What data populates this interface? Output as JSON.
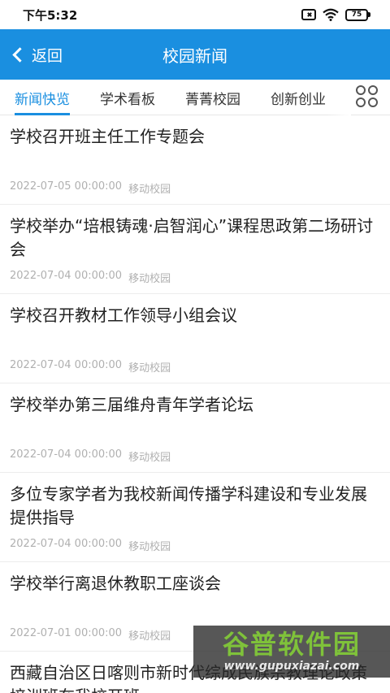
{
  "status_bar": {
    "time": "下午5:32",
    "battery": "75",
    "icons": [
      "sim-off-icon",
      "wifi-icon",
      "battery-icon"
    ]
  },
  "nav": {
    "back_label": "返回",
    "title": "校园新闻"
  },
  "tabs": [
    {
      "label": "新闻快览",
      "active": true
    },
    {
      "label": "学术看板",
      "active": false
    },
    {
      "label": "菁菁校园",
      "active": false
    },
    {
      "label": "创新创业",
      "active": false
    }
  ],
  "news": [
    {
      "title": "学校召开班主任工作专题会",
      "date": "2022-07-05 00:00:00",
      "source": "移动校园"
    },
    {
      "title": "学校举办“培根铸魂·启智润心”课程思政第二场研讨会",
      "date": "2022-07-04 00:00:00",
      "source": "移动校园"
    },
    {
      "title": "学校召开教材工作领导小组会议",
      "date": "2022-07-04 00:00:00",
      "source": "移动校园"
    },
    {
      "title": "学校举办第三届维舟青年学者论坛",
      "date": "2022-07-04 00:00:00",
      "source": "移动校园"
    },
    {
      "title": "多位专家学者为我校新闻传播学科建设和专业发展提供指导",
      "date": "2022-07-04 00:00:00",
      "source": "移动校园"
    },
    {
      "title": "学校举行离退休教职工座谈会",
      "date": "2022-07-01 00:00:00",
      "source": "移动校园"
    },
    {
      "title": "西藏自治区日喀则市新时代综成民族宗教理论政策培训班在我校开班",
      "date": "",
      "source": ""
    }
  ],
  "watermark": {
    "main": "谷普软件园",
    "sub": "www.gupuxiazai.com"
  },
  "colors": {
    "accent": "#1a8fe0",
    "meta": "#b0b0b0"
  }
}
